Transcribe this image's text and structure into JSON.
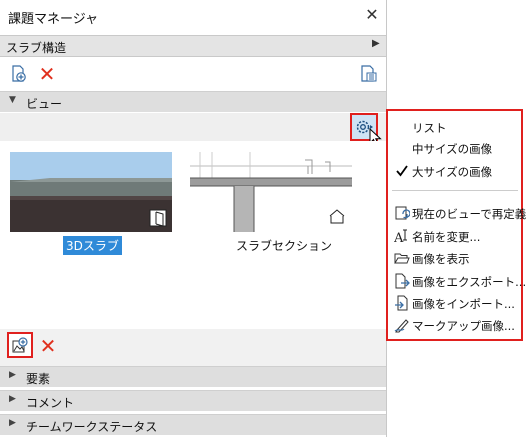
{
  "window": {
    "title": "課題マネージャ",
    "close_label": "✕"
  },
  "structure": {
    "selected": "スラブ構造"
  },
  "toolbar": {
    "add_icon": "add-document-icon",
    "delete_icon": "delete-x-icon",
    "options_icon": "list-settings-icon"
  },
  "sections": {
    "view": "ビュー",
    "elements": "要素",
    "comments": "コメント",
    "teamwork": "チームワークステータス"
  },
  "views": [
    {
      "caption": "3Dスラブ",
      "selected": true
    },
    {
      "caption": "スラブセクション",
      "selected": false
    }
  ],
  "menu": {
    "items": [
      {
        "label": "リスト",
        "icon": "",
        "checked": false
      },
      {
        "label": "中サイズの画像",
        "icon": "",
        "checked": false
      },
      {
        "label": "大サイズの画像",
        "icon": "checkmark-icon",
        "checked": true
      },
      {
        "label": "現在のビューで再定義",
        "icon": "redefine-view-icon"
      },
      {
        "label": "名前を変更...",
        "icon": "rename-icon"
      },
      {
        "label": "画像を表示",
        "icon": "open-folder-icon"
      },
      {
        "label": "画像をエクスポート...",
        "icon": "export-icon"
      },
      {
        "label": "画像をインポート...",
        "icon": "import-icon"
      },
      {
        "label": "マークアップ画像...",
        "icon": "markup-pen-icon"
      }
    ]
  },
  "colors": {
    "highlight_red": "#e0201e",
    "selection_blue": "#2f8ad8",
    "delete_red": "#e0301e"
  }
}
